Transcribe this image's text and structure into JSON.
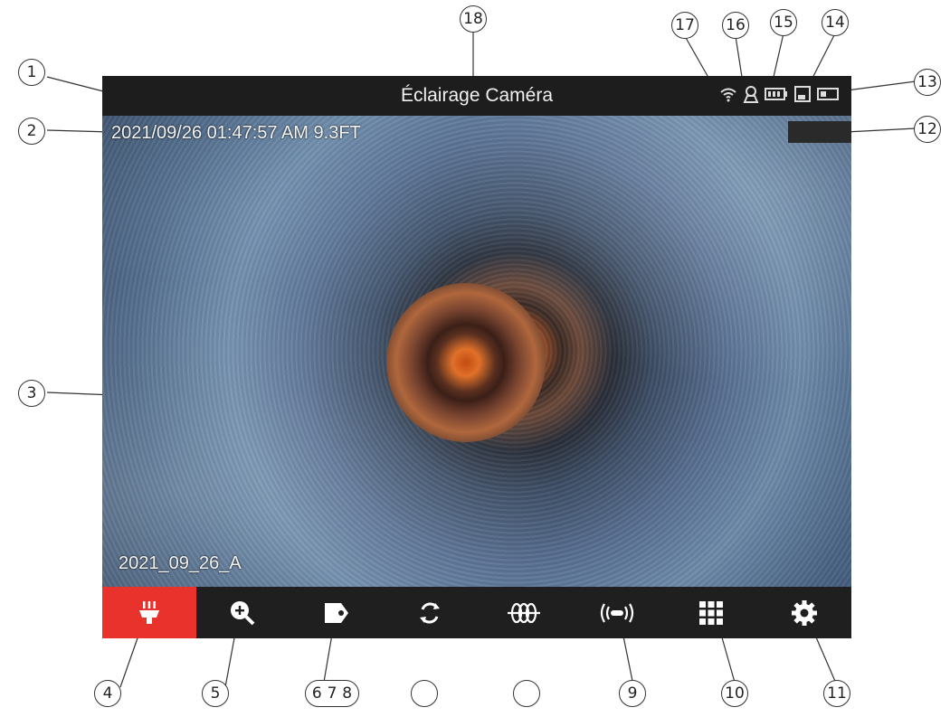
{
  "screen": {
    "title": "Éclairage Caméra",
    "datetime_overlay": "2021/09/26 01:47:57 AM 9.3FT",
    "folder_overlay": "2021_09_26_A",
    "status_icons": [
      "wifi-icon",
      "camera-person-icon",
      "battery-icon",
      "sd-card-icon",
      "storage-icon"
    ]
  },
  "toolbar": {
    "tools": [
      {
        "name": "light-icon",
        "active": true
      },
      {
        "name": "zoom-in-icon",
        "active": false
      },
      {
        "name": "tag-icon",
        "active": false
      },
      {
        "name": "rotate-icon",
        "active": false
      },
      {
        "name": "sonde-icon",
        "active": false
      },
      {
        "name": "transmitter-icon",
        "active": false
      },
      {
        "name": "grid-menu-icon",
        "active": false
      },
      {
        "name": "settings-gear-icon",
        "active": false
      }
    ]
  },
  "callouts": {
    "c1": "1",
    "c2": "2",
    "c3": "3",
    "c4": "4",
    "c5": "5",
    "c6": "6",
    "c7": "7",
    "c8": "8",
    "c9": "9",
    "c10": "10",
    "c11": "11",
    "c12": "12",
    "c13": "13",
    "c14": "14",
    "c15": "15",
    "c16": "16",
    "c17": "17",
    "c18": "18"
  },
  "colors": {
    "active_tool": "#e8322b",
    "bar_background": "#1d1d1d"
  }
}
